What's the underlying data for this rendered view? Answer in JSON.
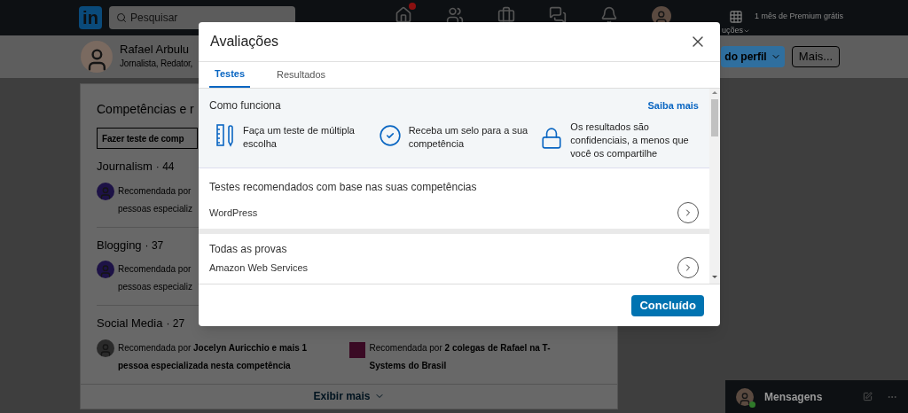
{
  "nav": {
    "logo": "in",
    "search": {
      "placeholder": "Pesquisar"
    },
    "home_badge": true,
    "solutions": "uções",
    "premium": "1 mês de Premium grátis"
  },
  "profile_bar": {
    "name": "Rafael Arbulu",
    "headline": "Jornalista, Redator,",
    "primary_button": "do perfil",
    "more_button": "Mais..."
  },
  "skills_card": {
    "title": "Competências e r",
    "test_button": "Fazer teste de comp",
    "skills": [
      {
        "name": "Journalism",
        "count": "· 44",
        "endorsements": [
          {
            "text": "Recomendada por",
            "text_2": "pessoas especializ"
          }
        ]
      },
      {
        "name": "Blogging",
        "count": "· 37",
        "endorsements": [
          {
            "text": "Recomendada por",
            "text_2": "pessoas especializ"
          }
        ]
      },
      {
        "name": "Social Media",
        "count": "· 27",
        "endorsements": [
          {
            "kind": "person",
            "text": "Recomendada por **Jocelyn Auricchio e mais 1**",
            "text_2": "**pessoa especializada nesta competência**"
          },
          {
            "kind": "company",
            "text": "Recomendada por **2 colegas de Rafael na T-**",
            "text_2": "**Systems do Brasil**"
          }
        ]
      }
    ],
    "show_more": "Exibir mais"
  },
  "messaging": {
    "label": "Mensagens",
    "online": true
  },
  "modal": {
    "title": "Avaliações",
    "tabs": [
      {
        "label": "Testes",
        "selected": true
      },
      {
        "label": "Resultados",
        "selected": false
      }
    ],
    "how_it_works": {
      "title": "Como funciona",
      "link": "Saiba mais",
      "steps": [
        {
          "kind": "ruler",
          "text": "Faça um teste de múltipla escolha"
        },
        {
          "kind": "check",
          "text": "Receba um selo para a sua competência"
        },
        {
          "kind": "lock",
          "text": "Os resultados são confidenciais, a menos que você os compartilhe"
        }
      ]
    },
    "sections": [
      {
        "title": "Testes recomendados com base nas suas competências",
        "items": [
          "WordPress"
        ]
      },
      {
        "title": "Todas as provas",
        "items": [
          "Amazon Web Services"
        ]
      }
    ],
    "done_button": "Concluído"
  }
}
